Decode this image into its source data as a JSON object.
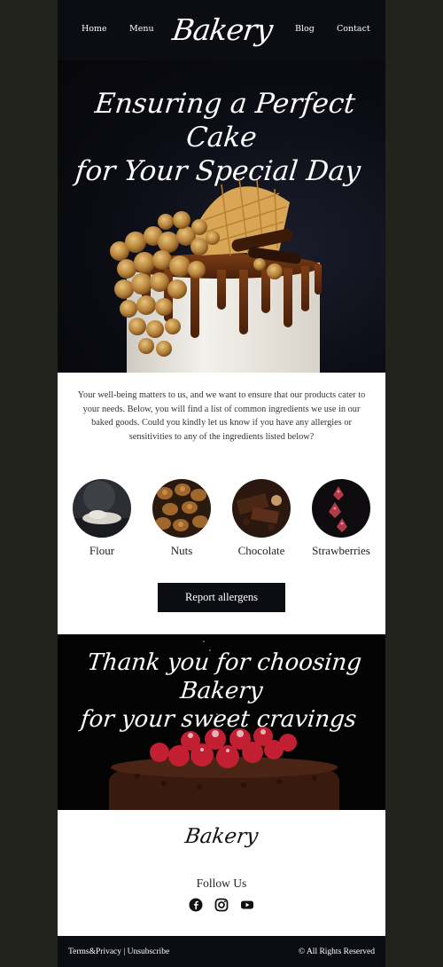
{
  "header": {
    "nav_left": [
      "Home",
      "Menu"
    ],
    "logo": "Bakery",
    "nav_right": [
      "Blog",
      "Contact"
    ]
  },
  "hero": {
    "title_line1": "Ensuring a Perfect Cake",
    "title_line2": "for Your Special Day"
  },
  "intro": {
    "text": "Your well-being matters to us, and we want to ensure that our products cater to your needs. Below, you will find a list of common ingredients we use in our baked goods. Could you kindly let us know if you have any allergies or sensitivities to any of the ingredients listed below?"
  },
  "ingredients": [
    {
      "label": "Flour"
    },
    {
      "label": "Nuts"
    },
    {
      "label": "Chocolate"
    },
    {
      "label": "Strawberries"
    }
  ],
  "cta": {
    "label": "Report allergens"
  },
  "thanks": {
    "line1": "Thank you for choosing Bakery",
    "line2": "for your sweet cravings"
  },
  "footer": {
    "logo": "Bakery",
    "follow": "Follow Us",
    "social_icons": [
      "facebook-icon",
      "instagram-icon",
      "youtube-icon"
    ],
    "terms": "Terms&Privacy",
    "separator": "|",
    "unsubscribe": "Unsubscribe",
    "rights": "© All Rights Reserved"
  },
  "colors": {
    "page_bg": "#23231e",
    "dark": "#0c0d12",
    "content_bg": "#ffffff",
    "text": "#333333"
  }
}
